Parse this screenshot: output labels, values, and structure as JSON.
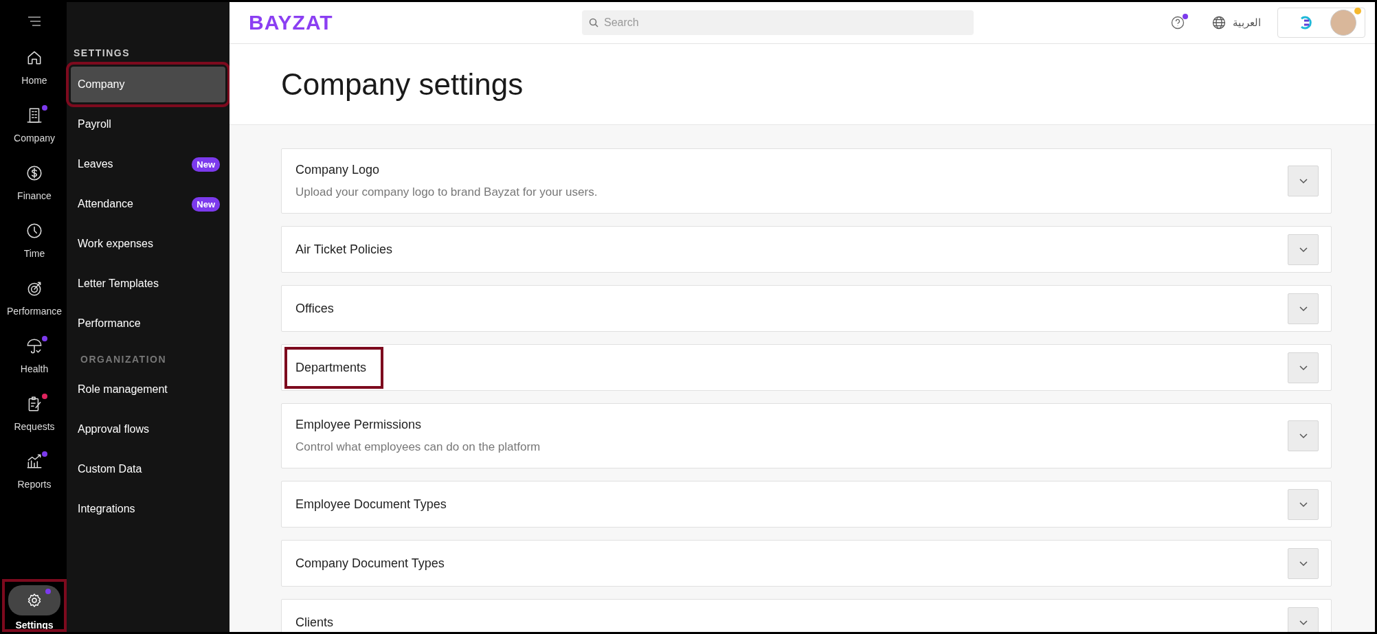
{
  "rail": {
    "items": [
      {
        "label": "Home",
        "selected": false
      },
      {
        "label": "Company",
        "selected": false,
        "color": "#7c3aed"
      },
      {
        "label": "Finance",
        "selected": false
      },
      {
        "label": "Time",
        "selected": false
      },
      {
        "label": "Performance",
        "selected": false
      },
      {
        "label": "Health",
        "selected": false,
        "color": "#7c3aed"
      },
      {
        "label": "Requests",
        "selected": false,
        "color": "#e0245e"
      },
      {
        "label": "Reports",
        "selected": false,
        "color": "#7c3aed"
      }
    ],
    "settings": {
      "label": "Settings",
      "selected": true,
      "highlighted": true,
      "color": "#7c3aed"
    }
  },
  "sidebar": {
    "sections": [
      {
        "title": "SETTINGS",
        "items": [
          {
            "label": "Company",
            "selected": true,
            "highlighted": true
          },
          {
            "label": "Payroll",
            "selected": false
          },
          {
            "label": "Leaves",
            "selected": false,
            "badge": "New"
          },
          {
            "label": "Attendance",
            "selected": false,
            "badge": "New"
          },
          {
            "label": "Work expenses",
            "selected": false
          },
          {
            "label": "Letter Templates",
            "selected": false
          },
          {
            "label": "Performance",
            "selected": false
          }
        ]
      },
      {
        "title": "ORGANIZATION",
        "items": [
          {
            "label": "Role management",
            "selected": false
          },
          {
            "label": "Approval flows",
            "selected": false
          },
          {
            "label": "Custom Data",
            "selected": false
          },
          {
            "label": "Integrations",
            "selected": false
          }
        ]
      }
    ]
  },
  "topbar": {
    "logo": "BAYZAT",
    "search": {
      "placeholder": "Search"
    },
    "language": "العربية"
  },
  "page": {
    "title": "Company settings"
  },
  "cards": [
    {
      "title": "Company Logo",
      "description": "Upload your company logo to brand Bayzat for your users.",
      "expanded": false
    },
    {
      "title": "Air Ticket Policies",
      "expanded": false
    },
    {
      "title": "Offices",
      "expanded": false
    },
    {
      "title": "Departments",
      "expanded": false,
      "highlighted": true
    },
    {
      "title": "Employee Permissions",
      "description": "Control what employees can do on the platform",
      "expanded": false
    },
    {
      "title": "Employee Document Types",
      "expanded": false
    },
    {
      "title": "Company Document Types",
      "expanded": false
    },
    {
      "title": "Clients",
      "expanded": false
    }
  ]
}
